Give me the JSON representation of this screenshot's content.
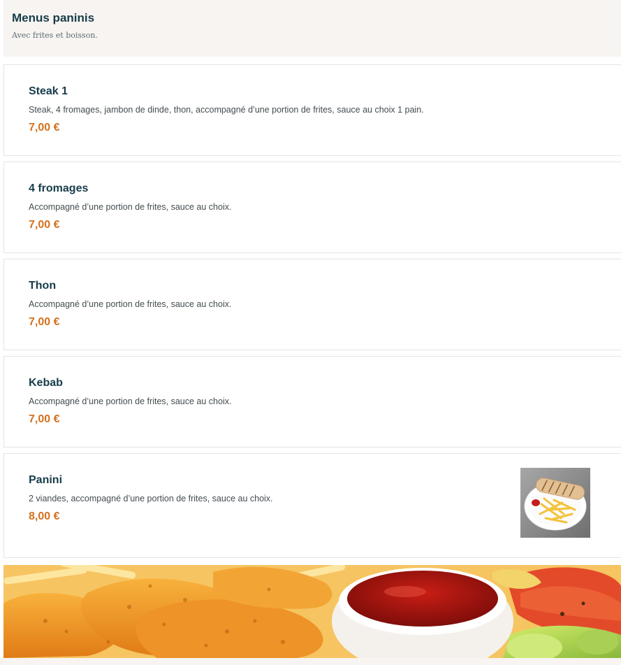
{
  "header": {
    "title": "Menus paninis",
    "subtitle": "Avec frites et boisson."
  },
  "items": [
    {
      "name": "Steak 1",
      "description": "Steak, 4 fromages, jambon de dinde, thon, accompagné d’une portion de frites, sauce au choix 1 pain.",
      "price": "7,00 €"
    },
    {
      "name": "4 fromages",
      "description": "Accompagné d’une portion de frites, sauce au choix.",
      "price": "7,00 €"
    },
    {
      "name": "Thon",
      "description": "Accompagné d’une portion de frites, sauce au choix.",
      "price": "7,00 €"
    },
    {
      "name": "Kebab",
      "description": "Accompagné d’une portion de frites, sauce au choix.",
      "price": "7,00 €"
    },
    {
      "name": "Panini",
      "description": "2 viandes, accompagné d’une portion de frites, sauce au choix.",
      "price": "8,00 €"
    }
  ],
  "colors": {
    "title": "#173c4a",
    "price": "#d4711d",
    "header_bg": "#f7f4f1"
  }
}
